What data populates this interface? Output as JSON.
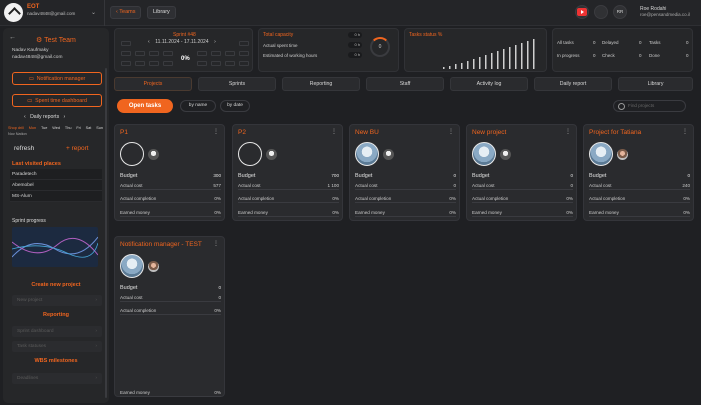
{
  "header": {
    "org_name": "EOT",
    "org_email": "nadav4848@gmail.com",
    "crumb_teams": "Teams",
    "crumb_library": "Library",
    "user_name": "Roe Rodahi",
    "user_email": "roe@pensandmedia.co.il",
    "user_initials": "RR"
  },
  "sidebar": {
    "team_name": "Test Team",
    "user_name": "Nadav Kaufmaky",
    "user_email": "nadav4848@gmail.com",
    "btn_notification": "Notification manager",
    "btn_spent_time": "Spent time dashboard",
    "daily_reports": "Daily reports",
    "day_labels": [
      "Shop drill",
      "Mon",
      "Tue",
      "Wed",
      "Thu",
      "Fri",
      "Sat",
      "Sun"
    ],
    "date_caption": "Nov Nation",
    "refresh": "refresh",
    "report": "+ report",
    "last_visited_title": "Last visited places",
    "last_visited": [
      "Paradetech",
      "Abemobel",
      "MS-Alum"
    ],
    "sprint_progress": "Sprint progress",
    "create_project": "Create new project",
    "new_project": "New project",
    "reporting_title": "Reporting",
    "sprint_dashboard": "Sprint dashboard",
    "task_statuses": "Task statuses",
    "wbs_title": "WBS milestones",
    "deadlines": "Deadlines"
  },
  "sprint_panel": {
    "title": "Sprint #48",
    "range": "11.11.2024 - 17.11.2024",
    "percent": "0%"
  },
  "capacity_panel": {
    "title": "Total capacity",
    "actual": "Actual spent time",
    "estimated": "Estimated of working hours",
    "val1": "0 h",
    "val2": "0 h",
    "val3": "0 h",
    "gauge": "0"
  },
  "status_panel": {
    "title": "Tasks status %"
  },
  "counters": {
    "all_tasks": "All tasks",
    "all_tasks_v": "0",
    "delayed": "Delayed",
    "delayed_v": "0",
    "tasks": "Tasks",
    "tasks_v": "0",
    "in_progress": "In progress",
    "in_progress_v": "0",
    "check": "Check",
    "check_v": "0",
    "done": "Done",
    "done_v": "0"
  },
  "tabs": [
    "Projects",
    "Sprints",
    "Reporting",
    "Staff",
    "Activity log",
    "Daily report",
    "Library"
  ],
  "toolbar": {
    "open_tasks": "Open tasks",
    "by_name": "by name",
    "by_date": "by date",
    "search_placeholder": "Find projects"
  },
  "labels": {
    "budget": "Budget",
    "actual_cost": "Actual cost",
    "actual_completion": "Actual completion",
    "earned_money": "Earned money"
  },
  "projects": [
    {
      "title": "P1",
      "budget": "300",
      "actual_cost": "577",
      "completion": "0%",
      "earned": "0%"
    },
    {
      "title": "P2",
      "budget": "700",
      "actual_cost": "1 100",
      "completion": "0%",
      "earned": "0%"
    },
    {
      "title": "New BU",
      "budget": "0",
      "actual_cost": "0",
      "completion": "0%",
      "earned": "0%"
    },
    {
      "title": "New project",
      "budget": "0",
      "actual_cost": "0",
      "completion": "0%",
      "earned": "0%"
    },
    {
      "title": "Project for Tatiana",
      "budget": "0",
      "actual_cost": "240",
      "completion": "0%",
      "earned": "0%"
    },
    {
      "title": "Notification manager - TEST",
      "budget": "0",
      "actual_cost": "0",
      "completion": "0%",
      "earned": "0%"
    }
  ]
}
